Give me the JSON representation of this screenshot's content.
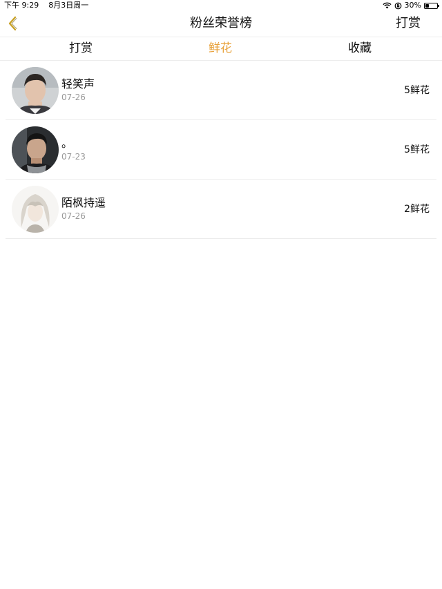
{
  "status_bar": {
    "time": "下午 9:29",
    "date": "8月3日周一",
    "battery_percent": "30%",
    "battery_level": 0.3,
    "icons": [
      "wifi-icon",
      "orientation-lock-icon",
      "battery-icon"
    ]
  },
  "nav": {
    "back_icon": "chevron-left-icon",
    "title": "粉丝荣誉榜",
    "action_label": "打赏"
  },
  "tabs": [
    {
      "label": "打赏",
      "active": false
    },
    {
      "label": "鲜花",
      "active": true
    },
    {
      "label": "收藏",
      "active": false
    }
  ],
  "colors": {
    "accent": "#e8a13a",
    "back_icon": "#c9a227",
    "divider": "#ececec",
    "secondary_text": "#9a9a9a"
  },
  "list": [
    {
      "name": "轻笑声",
      "date": "07-26",
      "amount": "5鲜花"
    },
    {
      "name": "。",
      "date": "07-23",
      "amount": "5鲜花"
    },
    {
      "name": "陌枫持遥",
      "date": "07-26",
      "amount": "2鲜花"
    }
  ]
}
